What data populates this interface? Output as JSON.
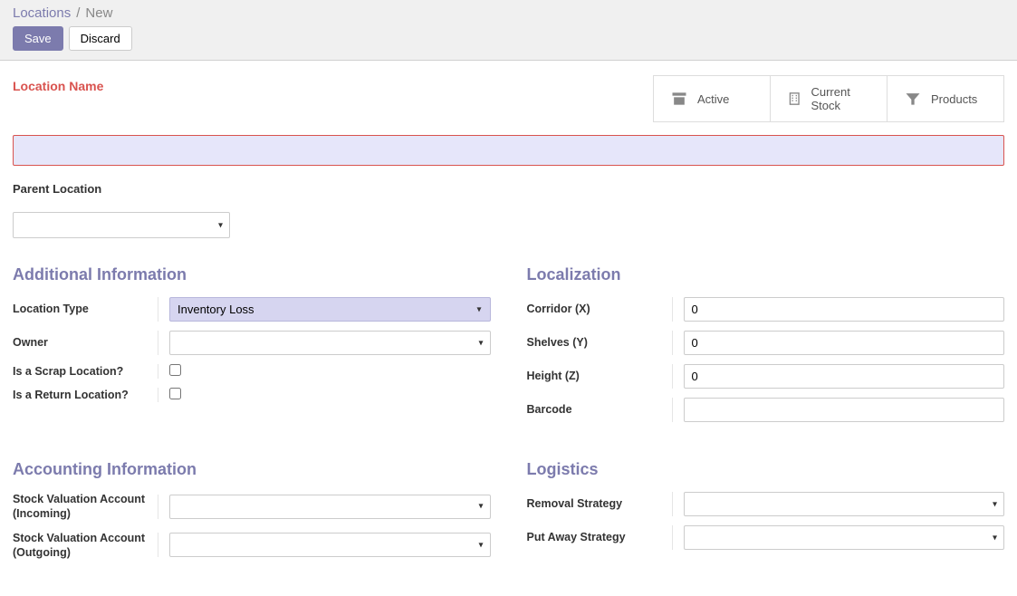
{
  "breadcrumb": {
    "parent": "Locations",
    "sep": "/",
    "current": "New"
  },
  "actions": {
    "save": "Save",
    "discard": "Discard"
  },
  "header": {
    "location_name_label": "Location Name",
    "location_name_value": ""
  },
  "stats": {
    "active": "Active",
    "current_stock": "Current Stock",
    "products": "Products"
  },
  "parent_location": {
    "label": "Parent Location",
    "value": ""
  },
  "additional": {
    "title": "Additional Information",
    "location_type_label": "Location Type",
    "location_type_value": "Inventory Loss",
    "owner_label": "Owner",
    "owner_value": "",
    "scrap_label": "Is a Scrap Location?",
    "scrap_checked": false,
    "return_label": "Is a Return Location?",
    "return_checked": false
  },
  "localization": {
    "title": "Localization",
    "corridor_label": "Corridor (X)",
    "corridor_value": "0",
    "shelves_label": "Shelves (Y)",
    "shelves_value": "0",
    "height_label": "Height (Z)",
    "height_value": "0",
    "barcode_label": "Barcode",
    "barcode_value": ""
  },
  "accounting": {
    "title": "Accounting Information",
    "incoming_label": "Stock Valuation Account (Incoming)",
    "incoming_value": "",
    "outgoing_label": "Stock Valuation Account (Outgoing)",
    "outgoing_value": ""
  },
  "logistics": {
    "title": "Logistics",
    "removal_label": "Removal Strategy",
    "removal_value": "",
    "putaway_label": "Put Away Strategy",
    "putaway_value": ""
  }
}
